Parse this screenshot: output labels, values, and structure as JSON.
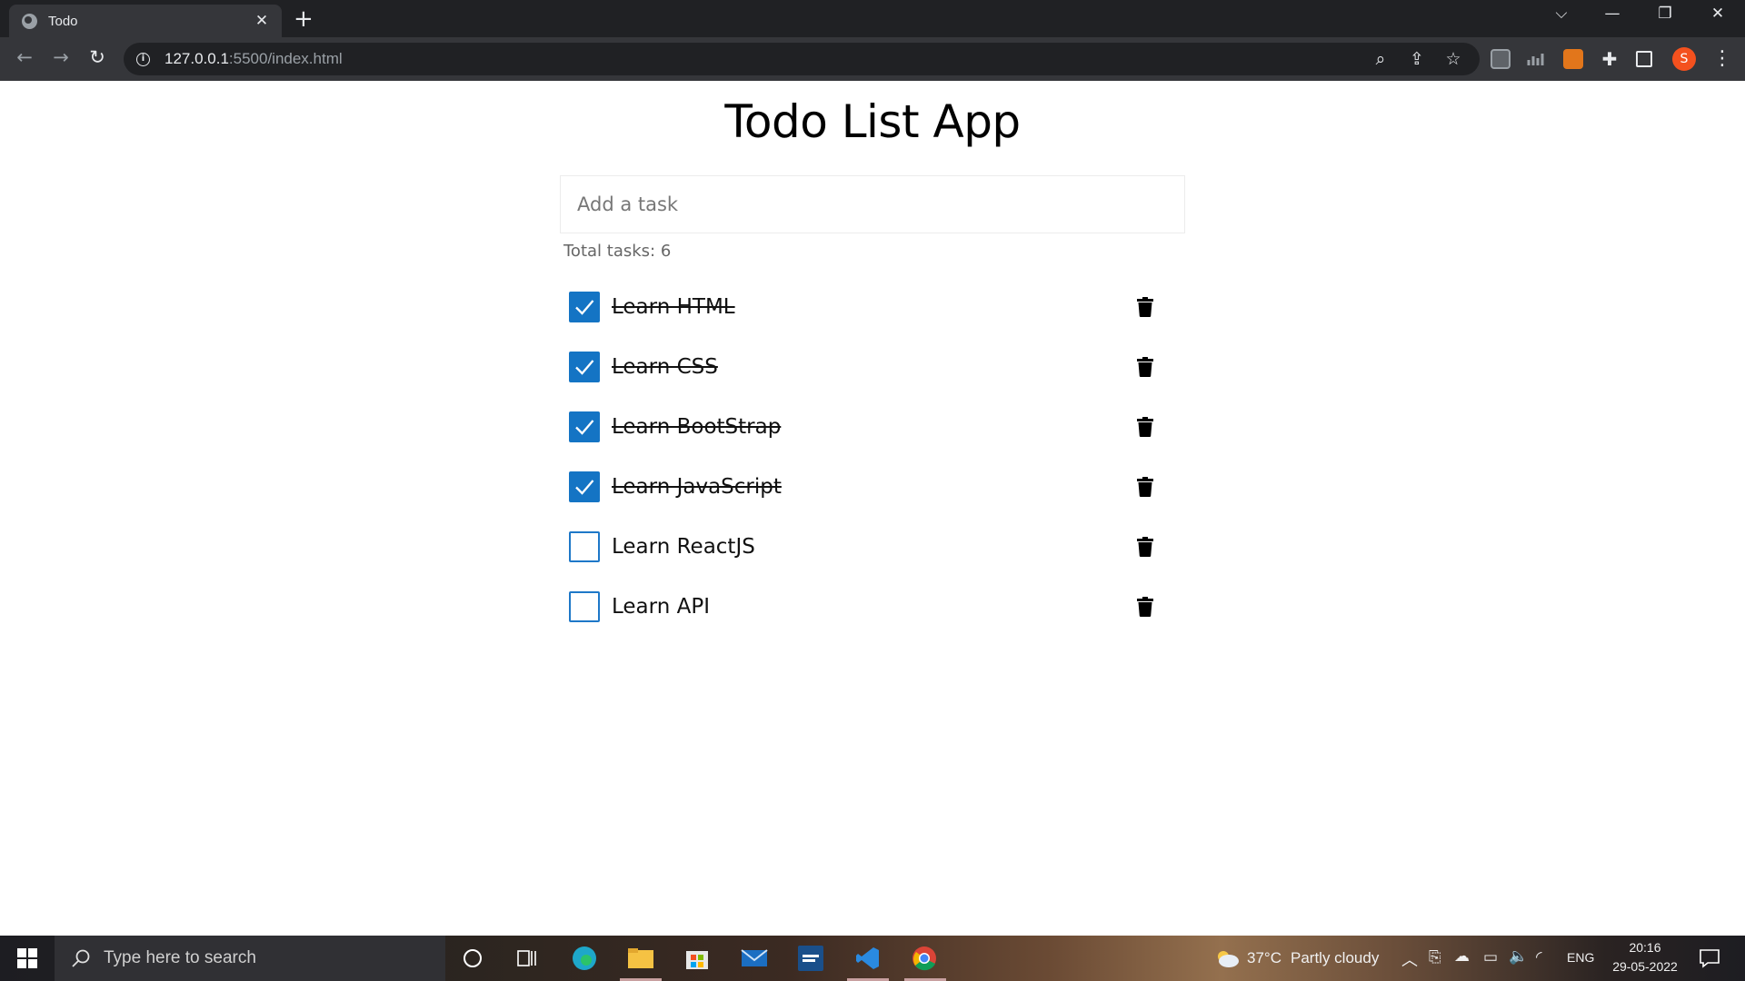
{
  "browser": {
    "tab_title": "Todo",
    "url_host": "127.0.0.1",
    "url_path": ":5500/index.html",
    "profile_initial": "S"
  },
  "app": {
    "title": "Todo List App",
    "input_placeholder": "Add a task",
    "total_tasks_label": "Total tasks: 6",
    "tasks": [
      {
        "label": "Learn HTML",
        "done": true
      },
      {
        "label": "Learn CSS",
        "done": true
      },
      {
        "label": "Learn BootStrap",
        "done": true
      },
      {
        "label": "Learn JavaScript",
        "done": true
      },
      {
        "label": "Learn ReactJS",
        "done": false
      },
      {
        "label": "Learn API",
        "done": false
      }
    ],
    "colors": {
      "check_blue": "#1474c4"
    }
  },
  "taskbar": {
    "search_placeholder": "Type here to search",
    "weather_temp": "37°C",
    "weather_desc": "Partly cloudy",
    "lang": "ENG",
    "time": "20:16",
    "date": "29-05-2022"
  }
}
